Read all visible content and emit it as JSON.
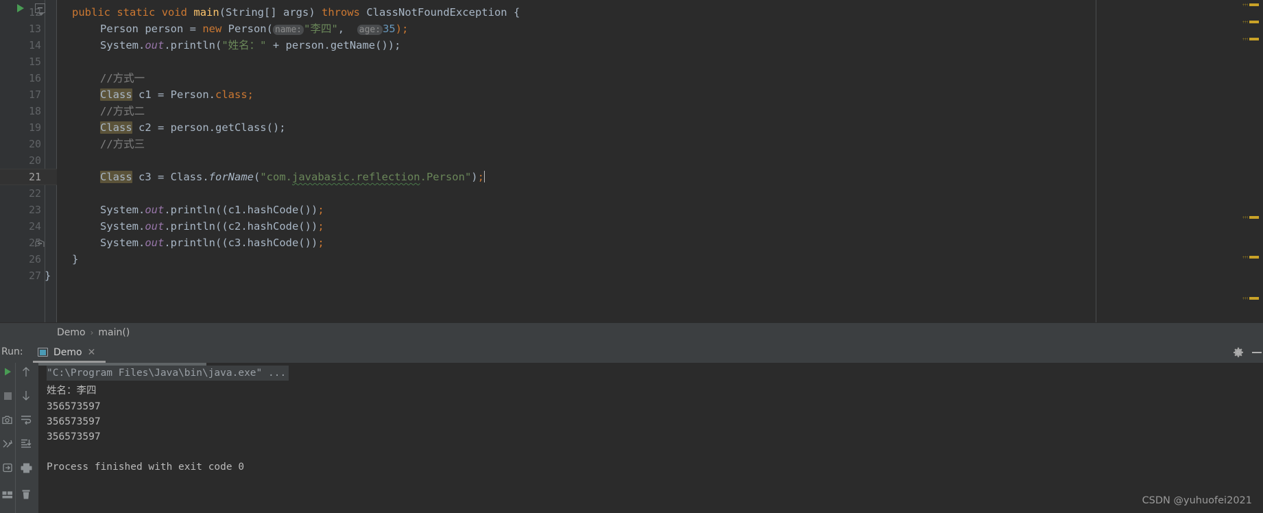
{
  "editor": {
    "lines": [
      {
        "num": "12",
        "indent": 0,
        "glyphs": [
          "run-arrow",
          "fold-minus"
        ]
      },
      {
        "num": "13",
        "indent": 0
      },
      {
        "num": "14",
        "indent": 0
      },
      {
        "num": "15",
        "indent": 0
      },
      {
        "num": "16",
        "indent": 0
      },
      {
        "num": "17",
        "indent": 0
      },
      {
        "num": "18",
        "indent": 0
      },
      {
        "num": "19",
        "indent": 0
      },
      {
        "num": "20",
        "indent": 0
      },
      {
        "num": "21",
        "indent": 0,
        "current": true
      },
      {
        "num": "22",
        "indent": 0
      },
      {
        "num": "23",
        "indent": 0
      },
      {
        "num": "24",
        "indent": 0
      },
      {
        "num": "25",
        "indent": 0
      },
      {
        "num": "26",
        "indent": 0,
        "glyphs": [
          "fold-end"
        ]
      },
      {
        "num": "27",
        "indent": 0
      }
    ],
    "code": {
      "l12": "public static void main(String[] args) throws ClassNotFoundException {",
      "l13": "Person person = new Person( name: \"李四\",  age: 35);",
      "l14": "System.out.println(\"姓名：\" + person.getName());",
      "l15": "",
      "l16": "//方式一",
      "l17": "Class c1 = Person.class;",
      "l18": "//方式二",
      "l19": "Class c2 = person.getClass();",
      "l20": "//方式三",
      "l21": "Class c3 = Class.forName(\"com.javabasic.reflection.Person\");",
      "l22": "",
      "l23": "System.out.println(c1.hashCode());",
      "l24": "System.out.println(c2.hashCode());",
      "l25": "System.out.println(c3.hashCode());",
      "l26": "}",
      "l27": "}"
    },
    "tokens": {
      "kw_public": "public",
      "kw_static": "static",
      "kw_void": "void",
      "mth_main": "main",
      "p_string_args": "(String[] args) ",
      "kw_throws": "throws",
      "p_cnfe": " ClassNotFoundException {",
      "p_person_person": "Person person = ",
      "kw_new": "new",
      "p_person_open": " Person(",
      "hint_name": "name:",
      "str_lisi": "\"李四\"",
      "p_comma": ",  ",
      "hint_age": "age:",
      "num_35": "35",
      "p_close": ");",
      "p_sysout_pre": "System.",
      "fld_out": "out",
      "p_println": ".println(",
      "str_xingming": "\"姓名：\"",
      "p_concat": " + person.getName());",
      "cmt_way1": "//方式一",
      "cmt_way2": "//方式二",
      "cmt_way3": "//方式三",
      "hl_class": "Class",
      "p_c1": " c1 = Person.",
      "kw_class": "class",
      "p_semi": ";",
      "p_c2": " c2 = person.getClass();",
      "p_c3": " c3 = Class.",
      "mth_forname": "forName",
      "p_paren_open": "(",
      "str_fqcn_a": "\"com.",
      "str_fqcn_b": "javabasic.reflection",
      "str_fqcn_c": ".Person\"",
      "p_paren_close": ")",
      "p_semi2": ";",
      "p_c1hash": "(c1.hashCode())",
      "p_c2hash": "(c2.hashCode())",
      "p_c3hash": "(c3.hashCode())",
      "brace_close": "}"
    },
    "stripe_marks": [
      5,
      30,
      55,
      315,
      373,
      433
    ]
  },
  "breadcrumb": {
    "items": [
      "Demo",
      "main()"
    ],
    "separator": "›"
  },
  "run_panel": {
    "label": "Run:",
    "tab": {
      "name": "Demo",
      "close": "✕",
      "icon": "run-configuration-icon"
    },
    "header_icons": [
      "gear-icon",
      "minimize-icon"
    ],
    "toolbar_left": [
      {
        "name": "rerun-icon",
        "glyph": "play"
      },
      {
        "name": "stop-icon",
        "glyph": "stop"
      },
      {
        "name": "camera-icon",
        "glyph": "camera"
      },
      {
        "name": "thread-dump-icon",
        "glyph": "threads"
      },
      {
        "name": "export-icon",
        "glyph": "export"
      },
      {
        "name": "layout-icon",
        "glyph": "layout"
      }
    ],
    "toolbar_right": [
      {
        "name": "up-arrow-icon",
        "glyph": "up"
      },
      {
        "name": "down-arrow-icon",
        "glyph": "down"
      },
      {
        "name": "soft-wrap-icon",
        "glyph": "wrap"
      },
      {
        "name": "scroll-to-end-icon",
        "glyph": "scrollend"
      },
      {
        "name": "print-icon",
        "glyph": "print"
      },
      {
        "name": "trash-icon",
        "glyph": "trash"
      }
    ],
    "console": {
      "command": "\"C:\\Program Files\\Java\\bin\\java.exe\" ...",
      "output": [
        "姓名：李四",
        "356573597",
        "356573597",
        "356573597",
        "",
        "Process finished with exit code 0"
      ]
    }
  },
  "watermark": "CSDN @yuhuofei2021",
  "colors": {
    "editor_bg": "#2b2b2b",
    "gutter_bg": "#313335",
    "panel_bg": "#3c3f41",
    "text": "#a9b7c6",
    "keyword": "#cc7832",
    "string": "#6a8759",
    "number": "#6897bb",
    "comment": "#808080",
    "field": "#9876aa",
    "method": "#ffc66d",
    "highlight": "#5b5339",
    "stripe_warning": "#c9a227",
    "run_green": "#499c54"
  }
}
